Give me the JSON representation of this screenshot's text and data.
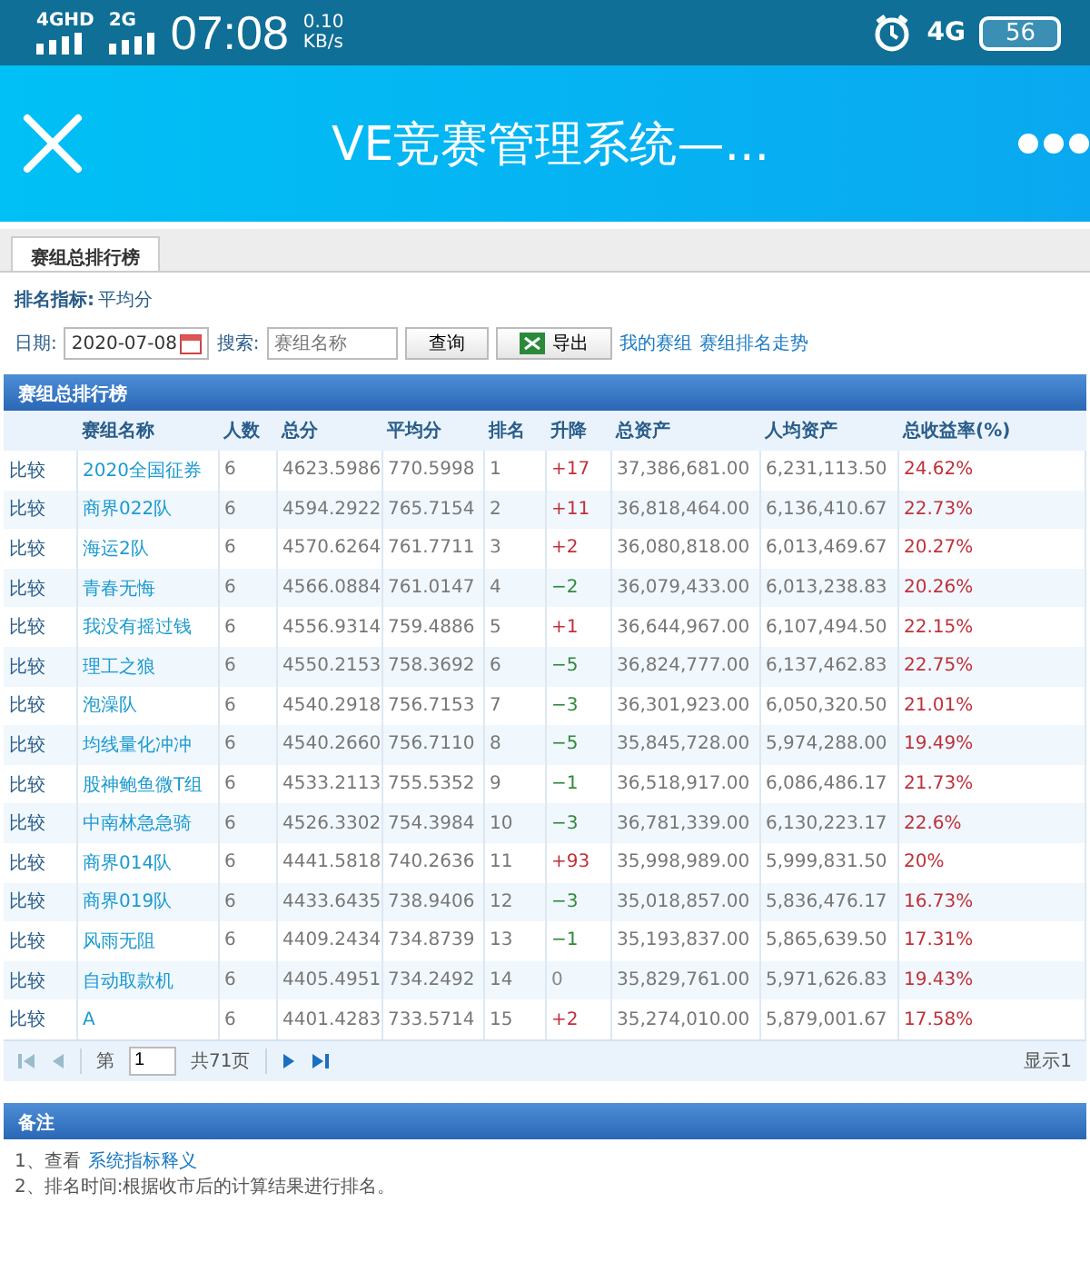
{
  "status_bar": {
    "network_1": "4GHD",
    "network_2": "2G",
    "time": "07:08",
    "speed_value": "0.10",
    "speed_unit": "KB/s",
    "network_3": "4G",
    "battery": "56"
  },
  "header": {
    "title": "VE竞赛管理系统—..."
  },
  "tabs": [
    {
      "label": "赛组总排行榜",
      "selected": true
    }
  ],
  "indicator": {
    "label": "排名指标:",
    "value": "平均分"
  },
  "toolbar": {
    "date_label": "日期:",
    "date_value": "2020-07-08",
    "search_label": "搜索:",
    "search_placeholder": "赛组名称",
    "query_button": "查询",
    "export_button": "导出",
    "links": [
      "我的赛组",
      "赛组排名走势"
    ]
  },
  "table": {
    "title": "赛组总排行榜",
    "columns": [
      "",
      "赛组名称",
      "人数",
      "总分",
      "平均分",
      "排名",
      "升降",
      "总资产",
      "人均资产",
      "总收益率(%)"
    ],
    "rows": [
      {
        "kind": "up",
        "action": "比较",
        "name": "2020全国征券",
        "count": "6",
        "total": "4623.5986",
        "avg": "770.5998",
        "rank": "1",
        "change": "+17",
        "assets": "37,386,681.00",
        "per_capita": "6,231,113.50",
        "yield": "24.62%"
      },
      {
        "kind": "up",
        "action": "比较",
        "name": "商界022队",
        "count": "6",
        "total": "4594.2922",
        "avg": "765.7154",
        "rank": "2",
        "change": "+11",
        "assets": "36,818,464.00",
        "per_capita": "6,136,410.67",
        "yield": "22.73%"
      },
      {
        "kind": "up",
        "action": "比较",
        "name": "海运2队",
        "count": "6",
        "total": "4570.6264",
        "avg": "761.7711",
        "rank": "3",
        "change": "+2",
        "assets": "36,080,818.00",
        "per_capita": "6,013,469.67",
        "yield": "20.27%"
      },
      {
        "kind": "down",
        "action": "比较",
        "name": "青春无悔",
        "count": "6",
        "total": "4566.0884",
        "avg": "761.0147",
        "rank": "4",
        "change": "−2",
        "assets": "36,079,433.00",
        "per_capita": "6,013,238.83",
        "yield": "20.26%"
      },
      {
        "kind": "up",
        "action": "比较",
        "name": "我没有摇过钱",
        "count": "6",
        "total": "4556.9314",
        "avg": "759.4886",
        "rank": "5",
        "change": "+1",
        "assets": "36,644,967.00",
        "per_capita": "6,107,494.50",
        "yield": "22.15%"
      },
      {
        "kind": "down",
        "action": "比较",
        "name": "理工之狼",
        "count": "6",
        "total": "4550.2153",
        "avg": "758.3692",
        "rank": "6",
        "change": "−5",
        "assets": "36,824,777.00",
        "per_capita": "6,137,462.83",
        "yield": "22.75%"
      },
      {
        "kind": "down",
        "action": "比较",
        "name": "泡澡队",
        "count": "6",
        "total": "4540.2918",
        "avg": "756.7153",
        "rank": "7",
        "change": "−3",
        "assets": "36,301,923.00",
        "per_capita": "6,050,320.50",
        "yield": "21.01%"
      },
      {
        "kind": "down",
        "action": "比较",
        "name": "均线量化冲冲",
        "count": "6",
        "total": "4540.2660",
        "avg": "756.7110",
        "rank": "8",
        "change": "−5",
        "assets": "35,845,728.00",
        "per_capita": "5,974,288.00",
        "yield": "19.49%"
      },
      {
        "kind": "down",
        "action": "比较",
        "name": "股神鲍鱼微T组",
        "count": "6",
        "total": "4533.2113",
        "avg": "755.5352",
        "rank": "9",
        "change": "−1",
        "assets": "36,518,917.00",
        "per_capita": "6,086,486.17",
        "yield": "21.73%"
      },
      {
        "kind": "down",
        "action": "比较",
        "name": "中南林急急骑",
        "count": "6",
        "total": "4526.3302",
        "avg": "754.3984",
        "rank": "10",
        "change": "−3",
        "assets": "36,781,339.00",
        "per_capita": "6,130,223.17",
        "yield": "22.6%"
      },
      {
        "kind": "up",
        "action": "比较",
        "name": "商界014队",
        "count": "6",
        "total": "4441.5818",
        "avg": "740.2636",
        "rank": "11",
        "change": "+93",
        "assets": "35,998,989.00",
        "per_capita": "5,999,831.50",
        "yield": "20%"
      },
      {
        "kind": "down",
        "action": "比较",
        "name": "商界019队",
        "count": "6",
        "total": "4433.6435",
        "avg": "738.9406",
        "rank": "12",
        "change": "−3",
        "assets": "35,018,857.00",
        "per_capita": "5,836,476.17",
        "yield": "16.73%"
      },
      {
        "kind": "down",
        "action": "比较",
        "name": "风雨无阻",
        "count": "6",
        "total": "4409.2434",
        "avg": "734.8739",
        "rank": "13",
        "change": "−1",
        "assets": "35,193,837.00",
        "per_capita": "5,865,639.50",
        "yield": "17.31%"
      },
      {
        "kind": "flat",
        "action": "比较",
        "name": "自动取款机",
        "count": "6",
        "total": "4405.4951",
        "avg": "734.2492",
        "rank": "14",
        "change": "0",
        "assets": "35,829,761.00",
        "per_capita": "5,971,626.83",
        "yield": "19.43%"
      },
      {
        "kind": "up",
        "action": "比较",
        "name": "A",
        "count": "6",
        "total": "4401.4283",
        "avg": "733.5714",
        "rank": "15",
        "change": "+2",
        "assets": "35,274,010.00",
        "per_capita": "5,879,001.67",
        "yield": "17.58%"
      }
    ]
  },
  "pager": {
    "buttons": [
      {
        "kind": "first",
        "disabled": true
      },
      {
        "kind": "prev",
        "disabled": true
      },
      {
        "kind": "next",
        "disabled": false
      },
      {
        "kind": "last",
        "disabled": false
      }
    ],
    "page_prefix": "第",
    "page_value": "1",
    "page_total": "共71页",
    "display_info": "显示1"
  },
  "notes": {
    "title": "备注",
    "lines": [
      {
        "text": "1、查看",
        "link": "系统指标释义"
      },
      {
        "text": "2、排名时间:根据收市后的计算结果进行排名。"
      }
    ]
  }
}
